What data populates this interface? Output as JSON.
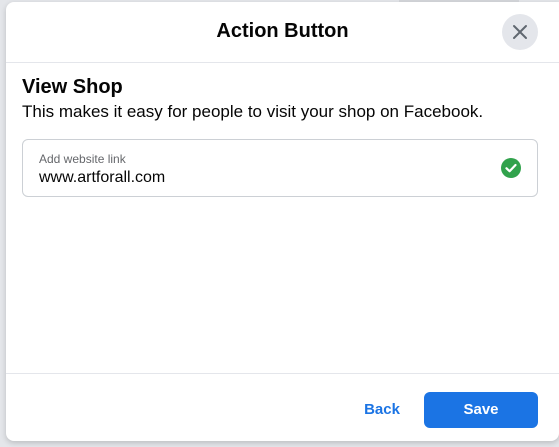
{
  "modal": {
    "title": "Action Button",
    "close_icon": "close-icon"
  },
  "section": {
    "title": "View Shop",
    "description": "This makes it easy for people to visit your shop on Facebook."
  },
  "website_field": {
    "label": "Add website link",
    "value": "www.artforall.com",
    "status_icon": "check-circle-icon",
    "status_color": "#31a24c"
  },
  "footer": {
    "back_label": "Back",
    "save_label": "Save"
  },
  "colors": {
    "accent": "#1b74e4",
    "success": "#31a24c"
  }
}
